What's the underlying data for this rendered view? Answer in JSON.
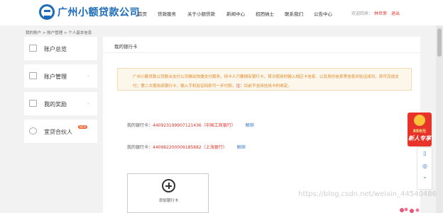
{
  "header": {
    "logo_text": "广州小额贷款公司",
    "nav": [
      "首页",
      "贷款服务",
      "关于小额贷款",
      "新闻中心",
      "招团纳士",
      "联系我们",
      "公告中心"
    ],
    "welcome": "欢迎回来：",
    "username": "林世荣",
    "logout": "退出"
  },
  "breadcrumb": "我的账户 > 账户管理 > 个人基本信息",
  "sidebar": {
    "items": [
      {
        "label": "账户总览",
        "icon": "monitor-icon"
      },
      {
        "label": "账户管理",
        "icon": "chart-icon"
      },
      {
        "label": "我的奖励",
        "icon": "gift-icon"
      },
      {
        "label": "宜贷合伙人",
        "icon": "partner-icon",
        "badge": "NEW"
      }
    ]
  },
  "main": {
    "title": "我的银行卡",
    "notice_text": "广州小额贷款公司联合支付公司推出快捷支付服务，持卡人只要拥有银行卡，首次使用时输入相应卡信息、以及身份信息等信息并验证成功，即可完成支付；第二次使用该银行卡，输入手机验证码即可一步付款。",
    "notice_red": "注：",
    "notice_tail": "目前不支持信用卡的绑定。",
    "cards": [
      {
        "label": "我的银行卡：",
        "number": "440923199907121436（中国工商银行）",
        "action": "解绑"
      },
      {
        "label": "我的银行卡：",
        "number": "440982200009185882（上海银行）",
        "action": "解绑"
      }
    ],
    "add_card_label": "添加银行卡"
  },
  "right_ad": {
    "amount": "888元",
    "text": "新人专享"
  },
  "watermark": "https://blog.csdn.net/weixin_44540486"
}
